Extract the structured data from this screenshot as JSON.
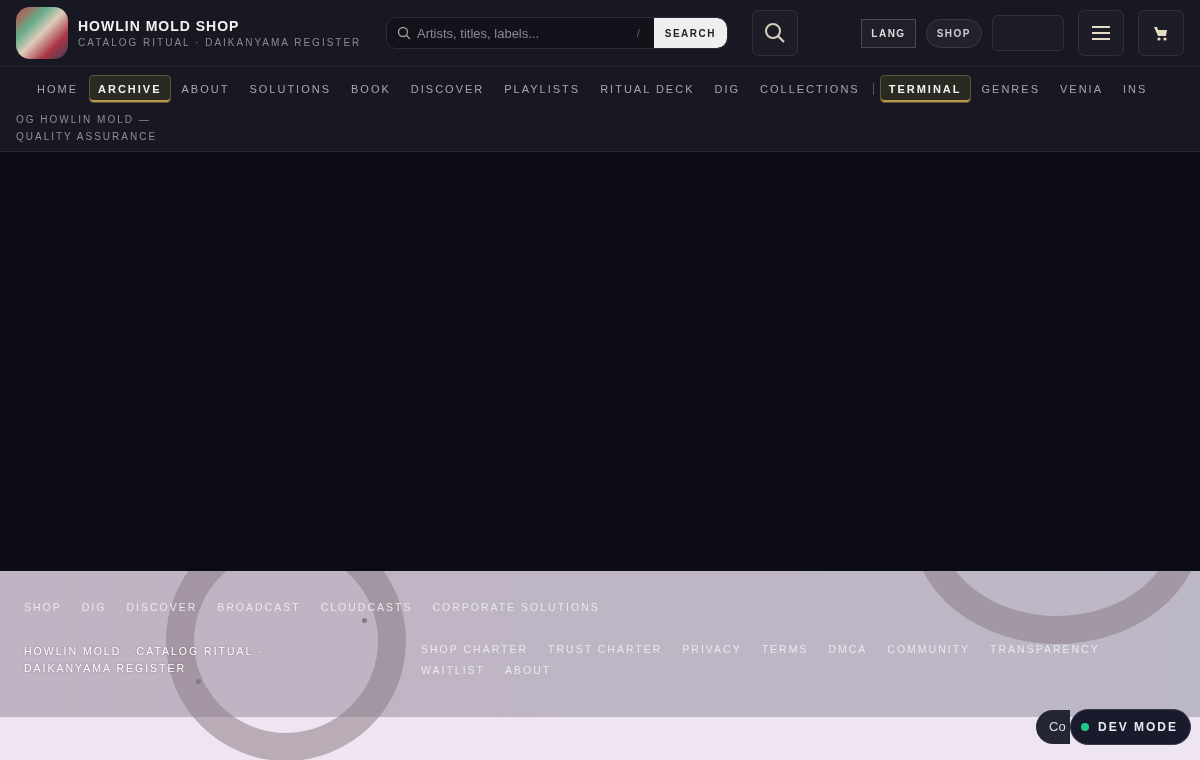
{
  "header": {
    "title": "HOWLIN MOLD SHOP",
    "subtitle": "CATALOG RITUAL · DAIKANYAMA REGISTER",
    "search": {
      "placeholder": "Artists, titles, labels...",
      "shortcut": "/",
      "button": "SEARCH"
    },
    "lang_button": "LANG",
    "shop_button": "SHOP"
  },
  "nav": [
    {
      "label": "HOME",
      "selected": false
    },
    {
      "label": "ARCHIVE",
      "selected": true
    },
    {
      "label": "ABOUT",
      "selected": false
    },
    {
      "label": "SOLUTIONS",
      "selected": false
    },
    {
      "label": "BOOK",
      "selected": false
    },
    {
      "label": "DISCOVER",
      "selected": false
    },
    {
      "label": "PLAYLISTS",
      "selected": false
    },
    {
      "label": "RITUAL DECK",
      "selected": false
    },
    {
      "label": "DIG",
      "selected": false
    },
    {
      "label": "COLLECTIONS",
      "selected": false
    },
    {
      "label": "TERMINAL",
      "selected": true
    },
    {
      "label": "GENRES",
      "selected": false
    },
    {
      "label": "VENIA",
      "selected": false
    },
    {
      "label": "INS",
      "selected": false
    }
  ],
  "tagline": "OG HOWLIN MOLD — QUALITY ASSURANCE",
  "footer": {
    "links": [
      "SHOP",
      "DIG",
      "DISCOVER",
      "BROADCAST",
      "CLOUDCASTS",
      "CORPORATE SOLUTIONS"
    ],
    "brand": "HOWLIN MOLD · CATALOG RITUAL · DAIKANYAMA REGISTER",
    "legal_links": [
      "SHOP CHARTER",
      "TRUST CHARTER",
      "PRIVACY",
      "TERMS",
      "DMCA",
      "COMMUNITY",
      "TRANSPARENCY",
      "WAITLIST",
      "ABOUT"
    ]
  },
  "chip": "Co",
  "dev_mode": {
    "label": "DEV MODE",
    "on": true
  }
}
